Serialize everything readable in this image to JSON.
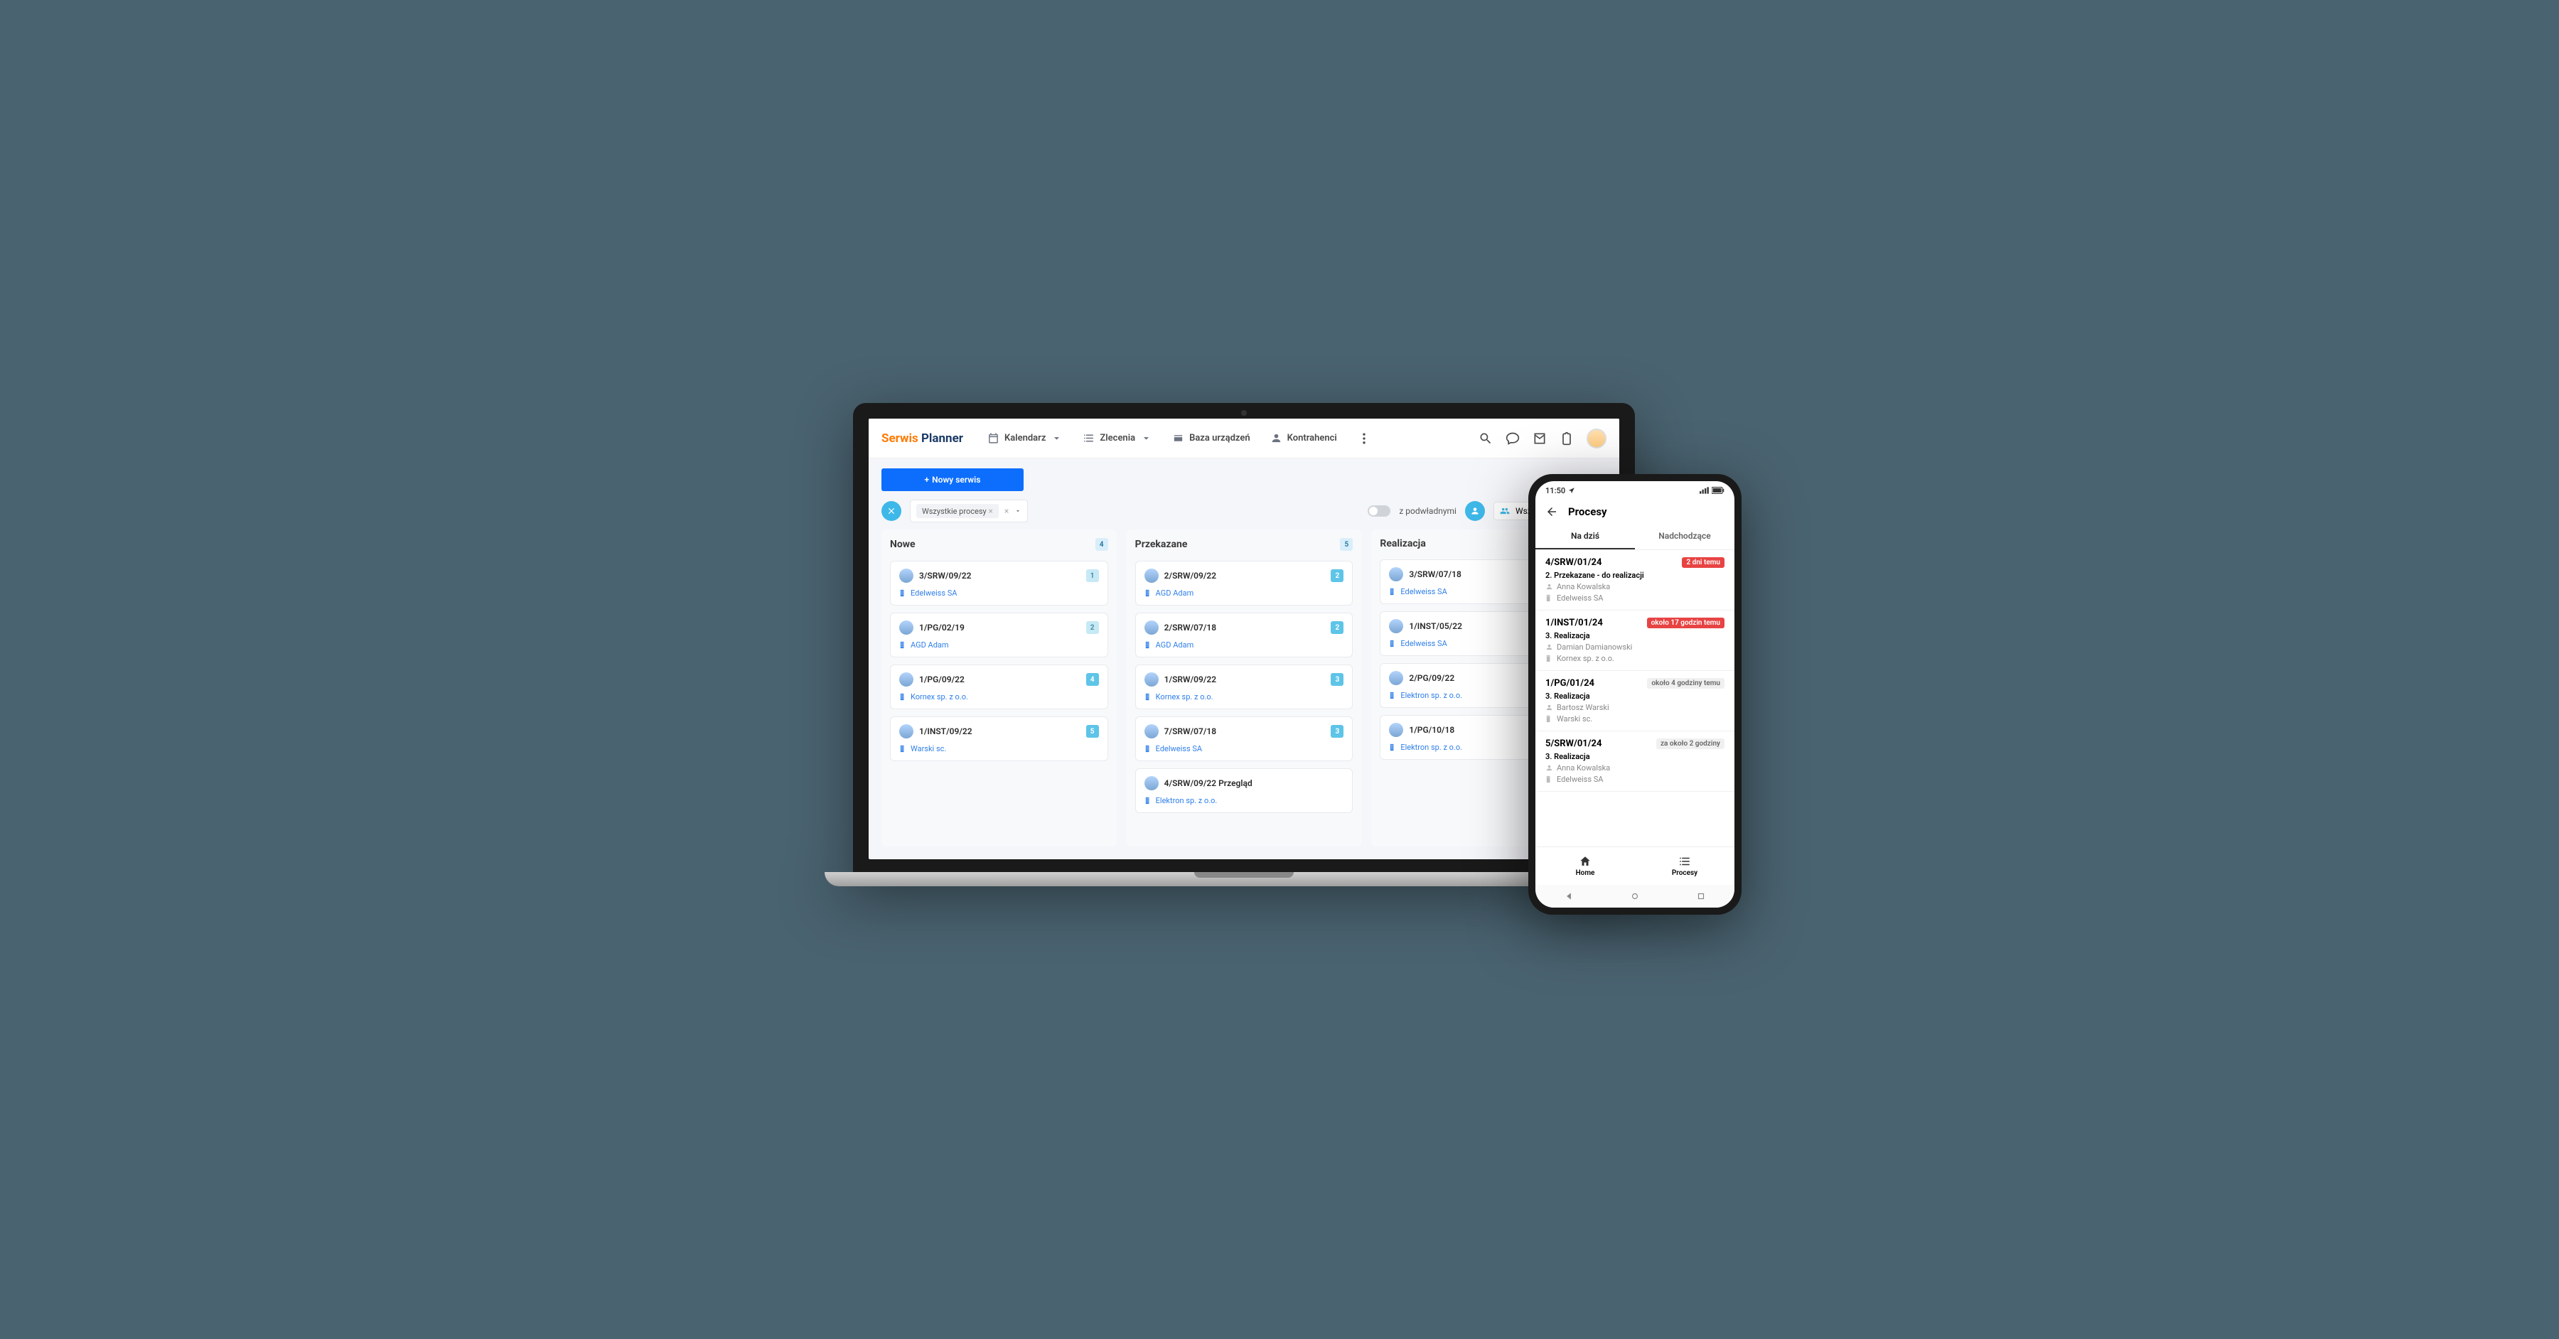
{
  "brand": {
    "part1": "Serwis",
    "part2": "Planner"
  },
  "nav": {
    "calendar": "Kalendarz",
    "orders": "Zlecenia",
    "devices": "Baza urządzeń",
    "contractors": "Kontrahenci"
  },
  "toolbar": {
    "new_service": "Nowy serwis"
  },
  "filters": {
    "all_processes": "Wszystkie procesy",
    "subordinates": "z podwładnymi",
    "everyone": "Wszyscy"
  },
  "columns": [
    {
      "title": "Nowe",
      "count": "4",
      "cards": [
        {
          "code": "3/SRW/09/22",
          "company": "Edelweiss SA",
          "badge": "1",
          "light": true
        },
        {
          "code": "1/PG/02/19",
          "company": "AGD Adam",
          "badge": "2",
          "light": true
        },
        {
          "code": "1/PG/09/22",
          "company": "Kornex sp. z o.o.",
          "badge": "4",
          "light": false
        },
        {
          "code": "1/INST/09/22",
          "company": "Warski sc.",
          "badge": "5",
          "light": false
        }
      ]
    },
    {
      "title": "Przekazane",
      "count": "5",
      "cards": [
        {
          "code": "2/SRW/09/22",
          "company": "AGD Adam",
          "badge": "2",
          "light": false
        },
        {
          "code": "2/SRW/07/18",
          "company": "AGD Adam",
          "badge": "2",
          "light": false
        },
        {
          "code": "1/SRW/09/22",
          "company": "Kornex sp. z o.o.",
          "badge": "3",
          "light": false
        },
        {
          "code": "7/SRW/07/18",
          "company": "Edelweiss SA",
          "badge": "3",
          "light": false
        },
        {
          "code": "4/SRW/09/22 Przegląd",
          "company": "Elektron sp. z o.o.",
          "badge": "",
          "light": false
        }
      ]
    },
    {
      "title": "Realizacja",
      "count": "",
      "cards": [
        {
          "code": "3/SRW/07/18",
          "company": "Edelweiss SA",
          "badge": "",
          "light": false
        },
        {
          "code": "1/INST/05/22",
          "company": "Edelweiss SA",
          "badge": "",
          "light": false
        },
        {
          "code": "2/PG/09/22",
          "company": "Elektron sp. z o.o.",
          "badge": "",
          "light": false
        },
        {
          "code": "1/PG/10/18",
          "company": "Elektron sp. z o.o.",
          "badge": "",
          "light": false
        }
      ]
    }
  ],
  "phone": {
    "time": "11:50",
    "title": "Procesy",
    "tabs": {
      "today": "Na dziś",
      "upcoming": "Nadchodzące"
    },
    "bottom": {
      "home": "Home",
      "processes": "Procesy"
    },
    "items": [
      {
        "code": "4/SRW/01/24",
        "badge": "2 dni temu",
        "badge_red": true,
        "status": "2. Przekazane - do realizacji",
        "person": "Anna Kowalska",
        "company": "Edelweiss SA"
      },
      {
        "code": "1/INST/01/24",
        "badge": "około 17 godzin temu",
        "badge_red": true,
        "status": "3. Realizacja",
        "person": "Damian Damianowski",
        "company": "Kornex sp. z o.o."
      },
      {
        "code": "1/PG/01/24",
        "badge": "około 4 godziny temu",
        "badge_red": false,
        "status": "3. Realizacja",
        "person": "Bartosz Warski",
        "company": "Warski sc."
      },
      {
        "code": "5/SRW/01/24",
        "badge": "za około 2 godziny",
        "badge_red": false,
        "status": "3. Realizacja",
        "person": "Anna Kowalska",
        "company": "Edelweiss SA"
      }
    ]
  }
}
